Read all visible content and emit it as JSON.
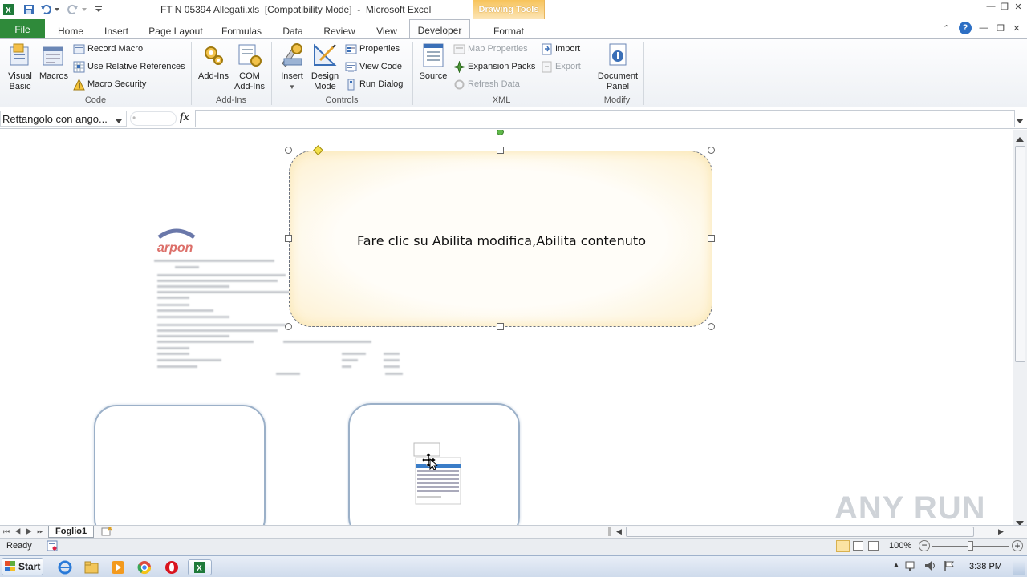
{
  "window": {
    "title": "FT N 05394 Allegati.xls  [Compatibility Mode]  -  Microsoft Excel",
    "contextual_tab_group": "Drawing Tools"
  },
  "tabs": [
    "File",
    "Home",
    "Insert",
    "Page Layout",
    "Formulas",
    "Data",
    "Review",
    "View",
    "Developer",
    "Format"
  ],
  "ribbon": {
    "code": {
      "label": "Code",
      "visual_basic": "Visual\nBasic",
      "macros": "Macros",
      "record_macro": "Record Macro",
      "use_relative_references": "Use Relative References",
      "macro_security": "Macro Security"
    },
    "addins": {
      "label": "Add-Ins",
      "addins": "Add-Ins",
      "com_addins": "COM\nAdd-Ins"
    },
    "controls": {
      "label": "Controls",
      "insert": "Insert",
      "design_mode": "Design\nMode",
      "properties": "Properties",
      "view_code": "View Code",
      "run_dialog": "Run Dialog"
    },
    "xml": {
      "label": "XML",
      "source": "Source",
      "map_properties": "Map Properties",
      "expansion_packs": "Expansion Packs",
      "refresh_data": "Refresh Data",
      "import": "Import",
      "export": "Export"
    },
    "modify": {
      "label": "Modify",
      "document_panel": "Document\nPanel"
    }
  },
  "formula_bar": {
    "name_box": "Rettangolo con ango...",
    "fx": "fx",
    "formula": ""
  },
  "sheet": {
    "shape_text": "Fare clic su Abilita modifica,Abilita contenuto",
    "logo_text": "arpon"
  },
  "sheet_tabs": [
    "Foglio1"
  ],
  "status": {
    "ready": "Ready",
    "zoom": "100%"
  },
  "taskbar": {
    "start": "Start",
    "clock": "3:38 PM"
  },
  "watermark": "ANY RUN",
  "colors": {
    "file_tab": "#2f8a3a",
    "drawing_tools": "#f7c35a",
    "shape_fill": "#fffdf5",
    "shape_glow": "#fbe6b0"
  }
}
